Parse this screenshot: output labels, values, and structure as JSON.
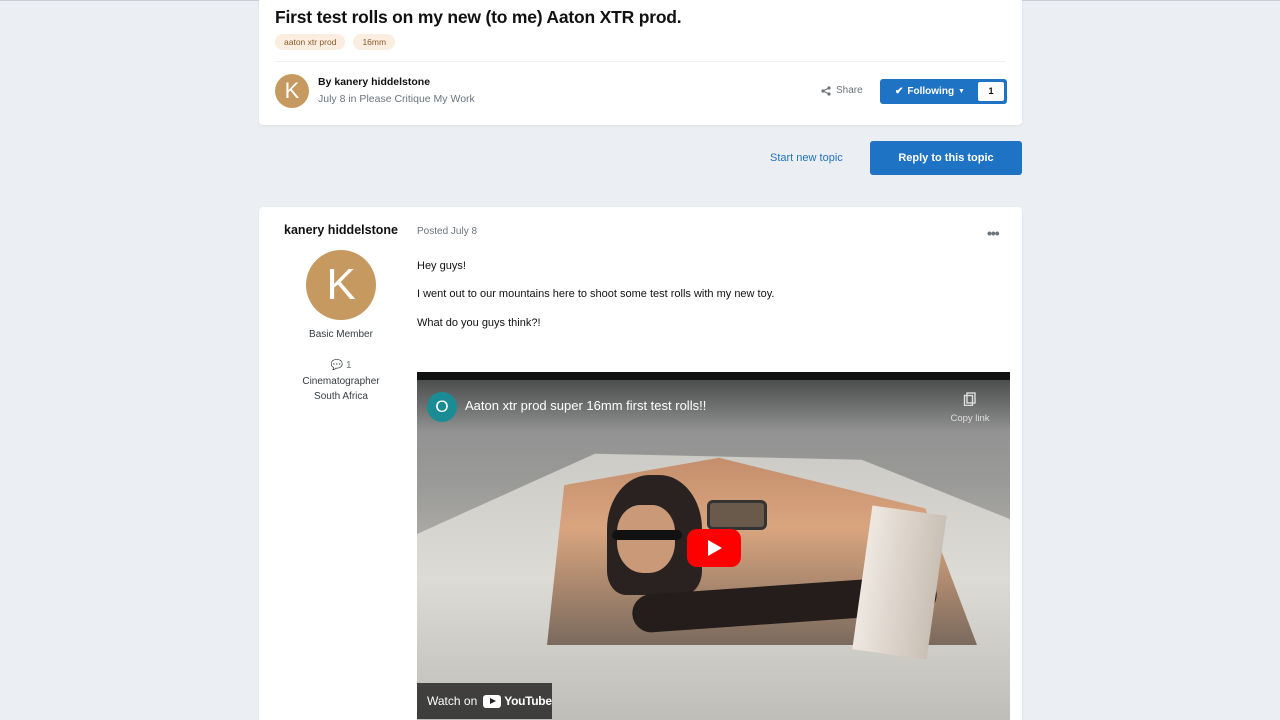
{
  "topic": {
    "title": "First test rolls on my new (to me) Aaton XTR prod.",
    "tags": [
      "aaton xtr prod",
      "16mm"
    ],
    "author_initial": "K",
    "by_prefix": "By",
    "author": "kanery hiddelstone",
    "meta": "July 8 in Please Critique My Work",
    "share_label": "Share",
    "following_label": "Following",
    "following_count": "1"
  },
  "actions": {
    "start_new_topic": "Start new topic",
    "reply": "Reply to this topic"
  },
  "post": {
    "author": {
      "name": "kanery hiddelstone",
      "initial": "K",
      "rank": "Basic Member",
      "post_count": "1",
      "title": "Cinematographer",
      "location": "South Africa"
    },
    "posted": "Posted July 8",
    "menu": "•••",
    "paragraphs": [
      "Hey guys!",
      "I went out to our mountains here to shoot some test rolls with my new toy.",
      "What do you guys think?!"
    ],
    "video": {
      "channel_initial": "O",
      "title": "Aaton xtr prod super 16mm first test rolls!!",
      "copy_link": "Copy link",
      "watch_on": "Watch on",
      "youtube": "YouTube"
    }
  },
  "colors": {
    "accent": "#1f73c4",
    "avatar": "#c5995f",
    "tag_bg": "#fbeee0",
    "page_bg": "#ebeef2"
  }
}
